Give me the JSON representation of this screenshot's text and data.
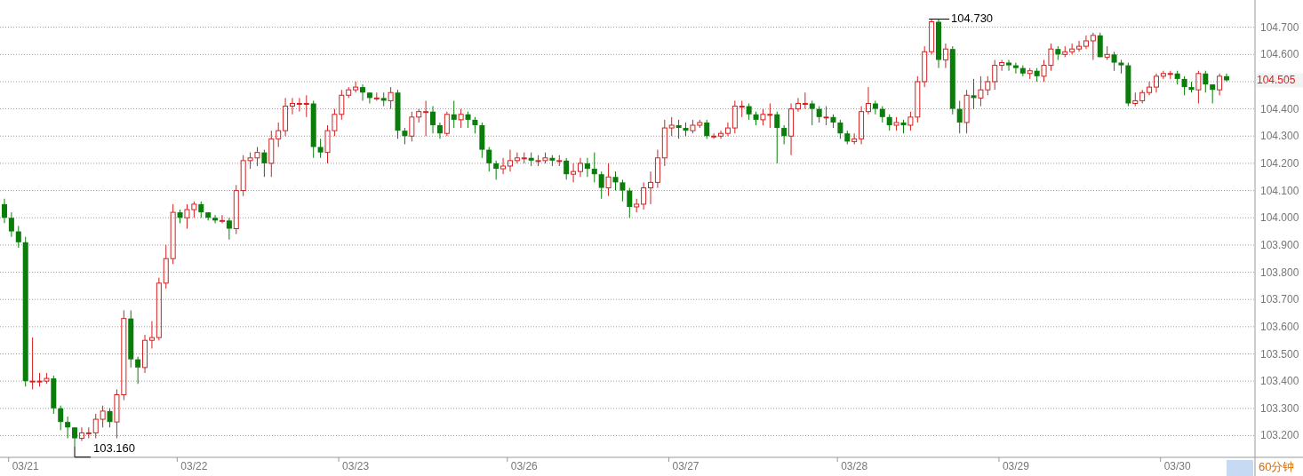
{
  "chart": {
    "chart_data": {
      "type": "candlestick",
      "grid": true,
      "ylim": [
        103.12,
        104.8
      ],
      "categories": [
        null,
        null,
        null,
        "03/21",
        null,
        null,
        null,
        null,
        null,
        null,
        null,
        null,
        null,
        null,
        null,
        null,
        null,
        null,
        null,
        null,
        null,
        null,
        null,
        null,
        null,
        null,
        null,
        "03/22",
        null,
        null,
        null,
        null,
        null,
        null,
        null,
        null,
        null,
        null,
        null,
        null,
        null,
        null,
        null,
        null,
        null,
        null,
        null,
        null,
        null,
        null,
        "03/23",
        null,
        null,
        null,
        null,
        null,
        null,
        null,
        null,
        null,
        null,
        null,
        null,
        null,
        null,
        null,
        null,
        null,
        null,
        null,
        null,
        null,
        null,
        null,
        "03/26",
        null,
        null,
        null,
        null,
        null,
        null,
        null,
        null,
        null,
        null,
        null,
        null,
        null,
        null,
        null,
        null,
        null,
        null,
        null,
        null,
        null,
        null,
        "03/27",
        null,
        null,
        null,
        null,
        null,
        null,
        null,
        null,
        null,
        null,
        null,
        null,
        null,
        null,
        null,
        null,
        null,
        null,
        null,
        null,
        null,
        null,
        null,
        "03/28",
        null,
        null,
        null,
        null,
        null,
        null,
        null,
        null,
        null,
        null,
        null,
        null,
        null,
        null,
        null,
        null,
        null,
        null,
        null,
        null,
        null,
        null,
        "03/29",
        null,
        null,
        null,
        null,
        null,
        null,
        null,
        null,
        null,
        null,
        null,
        null,
        null,
        null,
        null,
        null,
        null,
        null,
        null,
        null,
        null,
        null,
        "03/30",
        null,
        null,
        null,
        null,
        null,
        null,
        null
      ],
      "ohlc": [
        [
          104.05,
          104.07,
          103.98,
          104.0
        ],
        [
          104.0,
          104.02,
          103.93,
          103.95
        ],
        [
          103.95,
          103.97,
          103.89,
          103.91
        ],
        [
          103.91,
          103.93,
          103.38,
          103.4
        ],
        [
          103.4,
          103.56,
          103.37,
          103.4
        ],
        [
          103.4,
          103.43,
          103.38,
          103.4
        ],
        [
          103.4,
          103.43,
          103.39,
          103.41
        ],
        [
          103.41,
          103.42,
          103.28,
          103.3
        ],
        [
          103.3,
          103.31,
          103.22,
          103.25
        ],
        [
          103.25,
          103.27,
          103.19,
          103.23
        ],
        [
          103.23,
          103.23,
          103.16,
          103.19
        ],
        [
          103.19,
          103.23,
          103.18,
          103.21
        ],
        [
          103.21,
          103.23,
          103.19,
          103.21
        ],
        [
          103.21,
          103.28,
          103.19,
          103.26
        ],
        [
          103.26,
          103.31,
          103.23,
          103.29
        ],
        [
          103.29,
          103.3,
          103.23,
          103.25
        ],
        [
          103.25,
          103.37,
          103.19,
          103.35
        ],
        [
          103.35,
          103.66,
          103.33,
          103.63
        ],
        [
          103.63,
          103.66,
          103.45,
          103.48
        ],
        [
          103.48,
          103.49,
          103.39,
          103.45
        ],
        [
          103.45,
          103.57,
          103.43,
          103.55
        ],
        [
          103.55,
          103.62,
          103.52,
          103.56
        ],
        [
          103.56,
          103.78,
          103.55,
          103.76
        ],
        [
          103.76,
          103.9,
          103.74,
          103.85
        ],
        [
          103.85,
          104.05,
          103.83,
          104.02
        ],
        [
          104.02,
          104.03,
          103.98,
          104.0
        ],
        [
          104.0,
          104.05,
          103.96,
          104.03
        ],
        [
          104.03,
          104.06,
          104.0,
          104.05
        ],
        [
          104.05,
          104.06,
          104.0,
          104.02
        ],
        [
          104.02,
          104.02,
          103.99,
          104.0
        ],
        [
          104.0,
          104.01,
          103.98,
          103.99
        ],
        [
          103.99,
          104.01,
          103.98,
          103.99
        ],
        [
          103.99,
          104.0,
          103.92,
          103.96
        ],
        [
          103.96,
          104.12,
          103.94,
          104.1
        ],
        [
          104.1,
          104.23,
          104.08,
          104.21
        ],
        [
          104.21,
          104.24,
          104.18,
          104.22
        ],
        [
          104.22,
          104.26,
          104.19,
          104.24
        ],
        [
          104.24,
          104.25,
          104.15,
          104.2
        ],
        [
          104.2,
          104.32,
          104.15,
          104.29
        ],
        [
          104.29,
          104.35,
          104.26,
          104.32
        ],
        [
          104.32,
          104.44,
          104.3,
          104.41
        ],
        [
          104.41,
          104.44,
          104.38,
          104.42
        ],
        [
          104.42,
          104.44,
          104.39,
          104.42
        ],
        [
          104.42,
          104.45,
          104.37,
          104.42
        ],
        [
          104.42,
          104.43,
          104.22,
          104.26
        ],
        [
          104.26,
          104.29,
          104.22,
          104.24
        ],
        [
          104.24,
          104.34,
          104.2,
          104.32
        ],
        [
          104.32,
          104.4,
          104.3,
          104.38
        ],
        [
          104.38,
          104.47,
          104.36,
          104.45
        ],
        [
          104.45,
          104.48,
          104.44,
          104.47
        ],
        [
          104.47,
          104.5,
          104.46,
          104.48
        ],
        [
          104.48,
          104.49,
          104.43,
          104.46
        ],
        [
          104.46,
          104.46,
          104.42,
          104.44
        ],
        [
          104.44,
          104.46,
          104.43,
          104.44
        ],
        [
          104.44,
          104.46,
          104.41,
          104.43
        ],
        [
          104.43,
          104.48,
          104.4,
          104.46
        ],
        [
          104.46,
          104.47,
          104.29,
          104.32
        ],
        [
          104.32,
          104.33,
          104.27,
          104.3
        ],
        [
          104.3,
          104.39,
          104.28,
          104.37
        ],
        [
          104.37,
          104.4,
          104.35,
          104.39
        ],
        [
          104.39,
          104.43,
          104.3,
          104.39
        ],
        [
          104.39,
          104.41,
          104.31,
          104.34
        ],
        [
          104.34,
          104.35,
          104.29,
          104.31
        ],
        [
          104.31,
          104.39,
          104.3,
          104.38
        ],
        [
          104.38,
          104.43,
          104.33,
          104.36
        ],
        [
          104.36,
          104.4,
          104.33,
          104.38
        ],
        [
          104.38,
          104.39,
          104.33,
          104.36
        ],
        [
          104.36,
          104.37,
          104.31,
          104.34
        ],
        [
          104.34,
          104.35,
          104.22,
          104.25
        ],
        [
          104.25,
          104.26,
          104.17,
          104.2
        ],
        [
          104.2,
          104.21,
          104.14,
          104.18
        ],
        [
          104.18,
          104.22,
          104.16,
          104.19
        ],
        [
          104.19,
          104.25,
          104.17,
          104.21
        ],
        [
          104.21,
          104.24,
          104.2,
          104.22
        ],
        [
          104.22,
          104.24,
          104.2,
          104.22
        ],
        [
          104.22,
          104.24,
          104.19,
          104.21
        ],
        [
          104.21,
          104.23,
          104.19,
          104.21
        ],
        [
          104.21,
          104.24,
          104.2,
          104.22
        ],
        [
          104.22,
          104.23,
          104.19,
          104.21
        ],
        [
          104.21,
          104.23,
          104.19,
          104.21
        ],
        [
          104.21,
          104.22,
          104.14,
          104.16
        ],
        [
          104.16,
          104.2,
          104.13,
          104.17
        ],
        [
          104.17,
          104.22,
          104.15,
          104.2
        ],
        [
          104.2,
          104.22,
          104.15,
          104.18
        ],
        [
          104.18,
          104.24,
          104.13,
          104.16
        ],
        [
          104.16,
          104.17,
          104.07,
          104.11
        ],
        [
          104.11,
          104.2,
          104.08,
          104.15
        ],
        [
          104.15,
          104.17,
          104.1,
          104.13
        ],
        [
          104.13,
          104.14,
          104.06,
          104.1
        ],
        [
          104.1,
          104.11,
          104.0,
          104.04
        ],
        [
          104.04,
          104.07,
          104.02,
          104.05
        ],
        [
          104.05,
          104.13,
          104.03,
          104.11
        ],
        [
          104.11,
          104.17,
          104.05,
          104.13
        ],
        [
          104.13,
          104.25,
          104.11,
          104.22
        ],
        [
          104.22,
          104.36,
          104.19,
          104.33
        ],
        [
          104.33,
          104.37,
          104.3,
          104.34
        ],
        [
          104.34,
          104.36,
          104.29,
          104.33
        ],
        [
          104.33,
          104.35,
          104.3,
          104.32
        ],
        [
          104.32,
          104.36,
          104.31,
          104.34
        ],
        [
          104.34,
          104.36,
          104.33,
          104.35
        ],
        [
          104.35,
          104.36,
          104.29,
          104.3
        ],
        [
          104.3,
          104.31,
          104.29,
          104.3
        ],
        [
          104.3,
          104.32,
          104.29,
          104.31
        ],
        [
          104.31,
          104.35,
          104.3,
          104.33
        ],
        [
          104.33,
          104.43,
          104.31,
          104.41
        ],
        [
          104.41,
          104.43,
          104.37,
          104.41
        ],
        [
          104.41,
          104.42,
          104.36,
          104.38
        ],
        [
          104.38,
          104.39,
          104.34,
          104.36
        ],
        [
          104.36,
          104.4,
          104.34,
          104.38
        ],
        [
          104.38,
          104.42,
          104.33,
          104.38
        ],
        [
          104.38,
          104.39,
          104.2,
          104.33
        ],
        [
          104.33,
          104.34,
          104.27,
          104.3
        ],
        [
          104.3,
          104.42,
          104.23,
          104.4
        ],
        [
          104.4,
          104.44,
          104.39,
          104.42
        ],
        [
          104.42,
          104.46,
          104.4,
          104.42
        ],
        [
          104.42,
          104.43,
          104.34,
          104.4
        ],
        [
          104.4,
          104.41,
          104.35,
          104.37
        ],
        [
          104.37,
          104.41,
          104.34,
          104.37
        ],
        [
          104.37,
          104.38,
          104.33,
          104.35
        ],
        [
          104.35,
          104.36,
          104.29,
          104.31
        ],
        [
          104.31,
          104.32,
          104.27,
          104.28
        ],
        [
          104.28,
          104.31,
          104.27,
          104.29
        ],
        [
          104.29,
          104.41,
          104.27,
          104.39
        ],
        [
          104.39,
          104.48,
          104.38,
          104.42
        ],
        [
          104.42,
          104.43,
          104.38,
          104.4
        ],
        [
          104.4,
          104.41,
          104.35,
          104.37
        ],
        [
          104.37,
          104.38,
          104.32,
          104.34
        ],
        [
          104.34,
          104.37,
          104.32,
          104.35
        ],
        [
          104.35,
          104.36,
          104.31,
          104.34
        ],
        [
          104.34,
          104.39,
          104.32,
          104.37
        ],
        [
          104.37,
          104.52,
          104.35,
          104.5
        ],
        [
          104.5,
          104.63,
          104.48,
          104.61
        ],
        [
          104.61,
          104.73,
          104.6,
          104.72
        ],
        [
          104.72,
          104.73,
          104.55,
          104.58
        ],
        [
          104.58,
          104.64,
          104.55,
          104.62
        ],
        [
          104.62,
          104.63,
          104.38,
          104.4
        ],
        [
          104.4,
          104.43,
          104.31,
          104.35
        ],
        [
          104.35,
          104.47,
          104.31,
          104.45
        ],
        [
          104.45,
          104.51,
          104.4,
          104.44
        ],
        [
          104.44,
          104.52,
          104.41,
          104.47
        ],
        [
          104.47,
          104.52,
          104.45,
          104.5
        ],
        [
          104.5,
          104.58,
          104.47,
          104.56
        ],
        [
          104.56,
          104.58,
          104.54,
          104.57
        ],
        [
          104.57,
          104.58,
          104.54,
          104.56
        ],
        [
          104.56,
          104.57,
          104.53,
          104.55
        ],
        [
          104.55,
          104.56,
          104.52,
          104.53
        ],
        [
          104.53,
          104.55,
          104.51,
          104.54
        ],
        [
          104.54,
          104.55,
          104.5,
          104.52
        ],
        [
          104.52,
          104.58,
          104.5,
          104.56
        ],
        [
          104.56,
          104.64,
          104.54,
          104.62
        ],
        [
          104.62,
          104.63,
          104.58,
          104.6
        ],
        [
          104.6,
          104.63,
          104.59,
          104.61
        ],
        [
          104.61,
          104.64,
          104.6,
          104.62
        ],
        [
          104.62,
          104.65,
          104.61,
          104.63
        ],
        [
          104.63,
          104.67,
          104.62,
          104.65
        ],
        [
          104.65,
          104.68,
          104.58,
          104.67
        ],
        [
          104.67,
          104.68,
          104.59,
          104.59
        ],
        [
          104.59,
          104.63,
          104.58,
          104.6
        ],
        [
          104.6,
          104.61,
          104.54,
          104.57
        ],
        [
          104.57,
          104.58,
          104.53,
          104.56
        ],
        [
          104.56,
          104.57,
          104.41,
          104.42
        ],
        [
          104.42,
          104.46,
          104.41,
          104.43
        ],
        [
          104.43,
          104.47,
          104.42,
          104.46
        ],
        [
          104.46,
          104.5,
          104.45,
          104.48
        ],
        [
          104.48,
          104.53,
          104.46,
          104.52
        ],
        [
          104.52,
          104.54,
          104.51,
          104.53
        ],
        [
          104.53,
          104.54,
          104.51,
          104.53
        ],
        [
          104.53,
          104.54,
          104.49,
          104.51
        ],
        [
          104.51,
          104.52,
          104.45,
          104.48
        ],
        [
          104.48,
          104.5,
          104.46,
          104.47
        ],
        [
          104.47,
          104.54,
          104.42,
          104.53
        ],
        [
          104.53,
          104.54,
          104.46,
          104.49
        ],
        [
          104.49,
          104.49,
          104.42,
          104.47
        ],
        [
          104.47,
          104.53,
          104.45,
          104.52
        ],
        [
          104.52,
          104.53,
          104.5,
          104.505
        ]
      ],
      "yticks": [
        {
          "value": 104.7,
          "label": "104.700"
        },
        {
          "value": 104.6,
          "label": "104.600"
        },
        {
          "value": 104.4,
          "label": "104.400"
        },
        {
          "value": 104.3,
          "label": "104.300"
        },
        {
          "value": 104.2,
          "label": "104.200"
        },
        {
          "value": 104.1,
          "label": "104.100"
        },
        {
          "value": 104.0,
          "label": "104.000"
        },
        {
          "value": 103.9,
          "label": "103.900"
        },
        {
          "value": 103.8,
          "label": "103.800"
        },
        {
          "value": 103.7,
          "label": "103.700"
        },
        {
          "value": 103.6,
          "label": "103.600"
        },
        {
          "value": 103.5,
          "label": "103.500"
        },
        {
          "value": 103.4,
          "label": "103.400"
        },
        {
          "value": 103.3,
          "label": "103.300"
        },
        {
          "value": 103.2,
          "label": "103.200"
        }
      ],
      "annotations": [
        "104.730",
        "103.160"
      ]
    },
    "last_price": "104.505",
    "period": "60分钟"
  }
}
